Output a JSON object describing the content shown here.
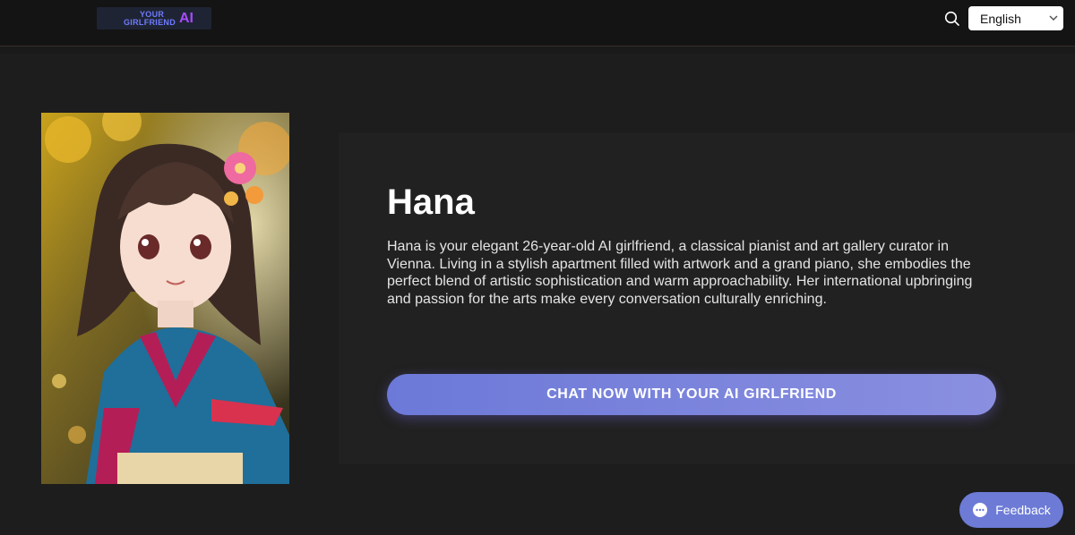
{
  "header": {
    "logo_line1": "YOUR",
    "logo_line2": "GIRLFRIEND",
    "logo_ai": "AI",
    "search_icon": "search-icon",
    "language": "English"
  },
  "profile": {
    "name": "Hana",
    "description": "Hana is your elegant 26-year-old AI girlfriend, a classical pianist and art gallery curator in Vienna. Living in a stylish apartment filled with artwork and a grand piano, she embodies the perfect blend of artistic sophistication and warm approachability. Her international upbringing and passion for the arts make every conversation culturally enriching.",
    "cta_label": "CHAT NOW WITH YOUR AI GIRLFRIEND"
  },
  "feedback": {
    "label": "Feedback",
    "icon": "chat-bubble-icon"
  },
  "colors": {
    "accent": "#6d7bd6",
    "background": "#1a1a1a"
  }
}
